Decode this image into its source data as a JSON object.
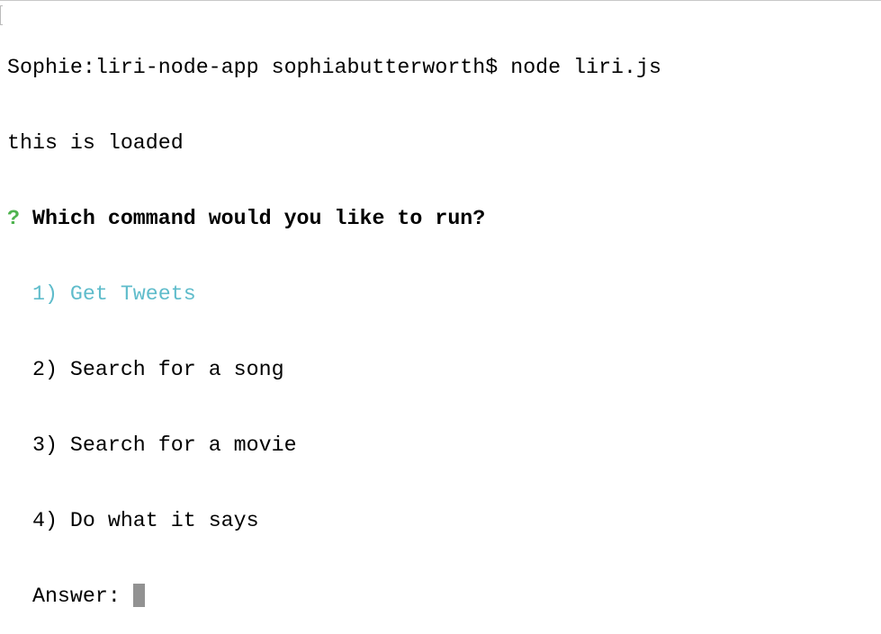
{
  "prompt_line": "Sophie:liri-node-app sophiabutterworth$ node liri.js",
  "output_line": "this is loaded",
  "question": {
    "marker": "?",
    "text": "Which command would you like to run?"
  },
  "options": [
    {
      "label": "1) Get Tweets",
      "selected": true
    },
    {
      "label": "2) Search for a song",
      "selected": false
    },
    {
      "label": "3) Search for a movie",
      "selected": false
    },
    {
      "label": "4) Do what it says",
      "selected": false
    }
  ],
  "answer_label": "Answer: ",
  "colors": {
    "selected": "#5fbccb",
    "question_mark": "#4fb34f",
    "cursor": "#929292"
  }
}
